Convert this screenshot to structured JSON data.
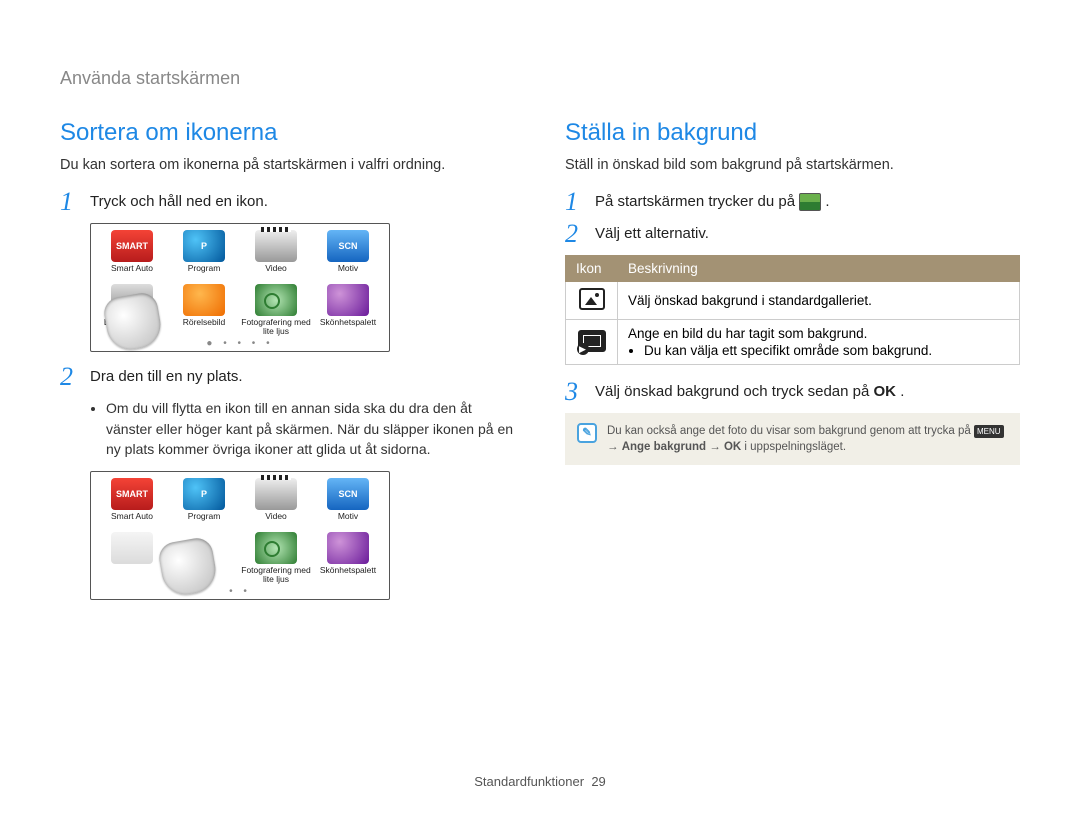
{
  "breadcrumb": "Använda startskärmen",
  "left": {
    "title": "Sortera om ikonerna",
    "intro": "Du kan sortera om ikonerna på startskärmen i valfri ordning.",
    "step1": "Tryck och håll ned en ikon.",
    "step2": "Dra den till en ny plats.",
    "bullet": "Om du vill flytta en ikon till en annan sida ska du dra den åt vänster eller höger kant på skärmen. När du släpper ikonen på en ny plats kommer övriga ikoner att glida ut åt sidorna.",
    "apps": {
      "smart": "Smart Auto",
      "program": "Program",
      "video": "Video",
      "motiv": "Motiv",
      "live": "Live panorama",
      "rorelse": "Rörelsebild",
      "foto": "Fotografering med lite ljus",
      "skon": "Skönhetspalett",
      "smart_badge": "SMART",
      "program_badge": "P",
      "motiv_badge": "SCN"
    },
    "dots1": "● • • • •",
    "dots2": "• •"
  },
  "right": {
    "title": "Ställa in bakgrund",
    "intro": "Ställ in önskad bild som bakgrund på startskärmen.",
    "step1_pre": "På startskärmen trycker du på ",
    "step1_post": ".",
    "step2": "Välj ett alternativ.",
    "table": {
      "th1": "Ikon",
      "th2": "Beskrivning",
      "row1": "Välj önskad bakgrund i standardgalleriet.",
      "row2_line1": "Ange en bild du har tagit som bakgrund.",
      "row2_bullet": "Du kan välja ett specifikt område som bakgrund."
    },
    "step3_pre": "Välj önskad bakgrund och tryck sedan på ",
    "step3_ok": "OK",
    "step3_post": ".",
    "note_pre": "Du kan också ange det foto du visar som bakgrund genom att trycka på ",
    "note_menu": "MENU",
    "note_mid1": " → ",
    "note_bold": "Ange bakgrund",
    "note_mid2": " → ",
    "note_ok": "OK",
    "note_post": " i uppspelningsläget."
  },
  "footer": {
    "section": "Standardfunktioner",
    "page": "29"
  }
}
